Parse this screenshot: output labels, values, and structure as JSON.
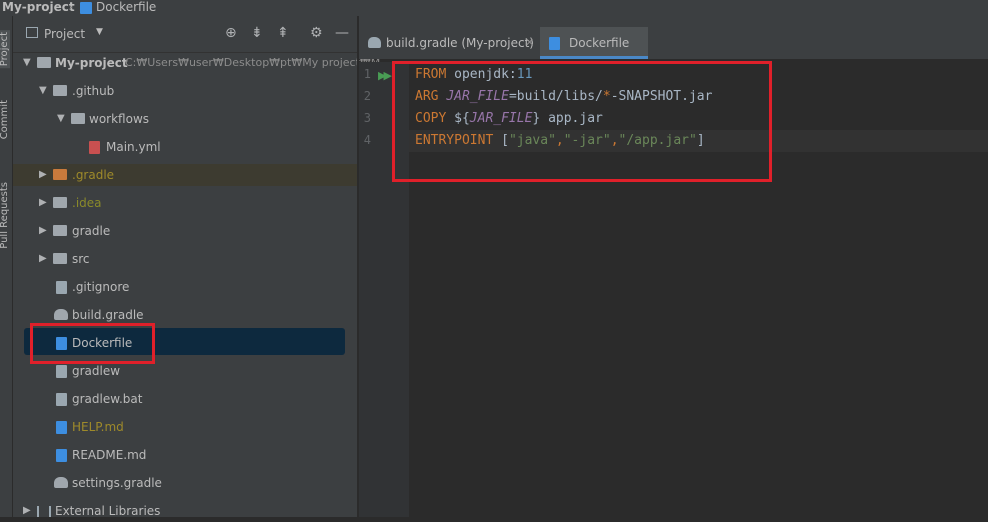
{
  "nav": {
    "project": "My-project",
    "separator": "›",
    "file": "Dockerfile"
  },
  "stripe": {
    "project": "Project",
    "commit": "Commit",
    "pull_requests": "Pull Requests"
  },
  "panel": {
    "title": "Project",
    "dropdown": "▼",
    "toolbar_icons": [
      "⊕",
      "⇟",
      "⇞",
      "⚙",
      "—"
    ]
  },
  "tree": {
    "root_label": "My-project",
    "root_path": "C:₩Users₩user₩Desktop₩pt₩My project₩M",
    "items": [
      {
        "label": ".github"
      },
      {
        "label": "workflows"
      },
      {
        "label": "Main.yml"
      },
      {
        "label": ".gradle"
      },
      {
        "label": ".idea"
      },
      {
        "label": "gradle"
      },
      {
        "label": "src"
      },
      {
        "label": ".gitignore"
      },
      {
        "label": "build.gradle"
      },
      {
        "label": "Dockerfile"
      },
      {
        "label": "gradlew"
      },
      {
        "label": "gradlew.bat"
      },
      {
        "label": "HELP.md"
      },
      {
        "label": "README.md"
      },
      {
        "label": "settings.gradle"
      },
      {
        "label": "External Libraries"
      }
    ]
  },
  "tabs": [
    {
      "label": "build.gradle (My-project)",
      "close": "✕"
    },
    {
      "label": "Dockerfile"
    }
  ],
  "editor": {
    "line_numbers": [
      "1",
      "2",
      "3",
      "4"
    ],
    "run_icon": "▶▶",
    "lines": {
      "l1": {
        "kw": "FROM",
        "t1": " openjdk:",
        "num": "11"
      },
      "l2": {
        "kw": "ARG",
        "sp": " ",
        "var": "JAR_FILE",
        "t1": "=build/libs/",
        "star": "*",
        "t2": "-SNAPSHOT.jar"
      },
      "l3": {
        "kw": "COPY",
        "t1": " ${",
        "var": "JAR_FILE",
        "t2": "} app.jar"
      },
      "l4": {
        "kw": "ENTRYPOINT",
        "t1": " [",
        "s1": "\"java\"",
        "c1": ",",
        "s2": "\"-jar\"",
        "c2": ",",
        "s3": "\"/app.jar\"",
        "t2": "]"
      }
    }
  },
  "colors": {
    "accent": "#4a88c7",
    "highlight": "#e0202a",
    "selection": "#0d293e"
  }
}
